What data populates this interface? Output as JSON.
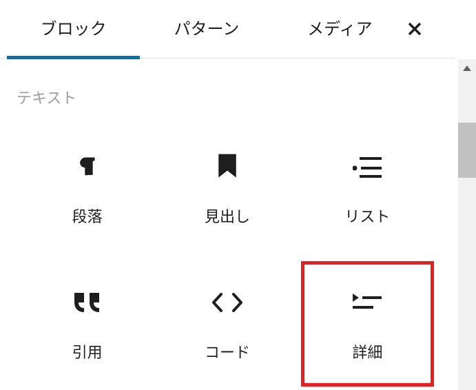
{
  "tabs": {
    "block": "ブロック",
    "pattern": "パターン",
    "media": "メディア"
  },
  "section": {
    "title": "テキスト"
  },
  "blocks": {
    "paragraph": {
      "label": "段落"
    },
    "heading": {
      "label": "見出し"
    },
    "list": {
      "label": "リスト"
    },
    "quote": {
      "label": "引用"
    },
    "code": {
      "label": "コード"
    },
    "details": {
      "label": "詳細"
    }
  }
}
